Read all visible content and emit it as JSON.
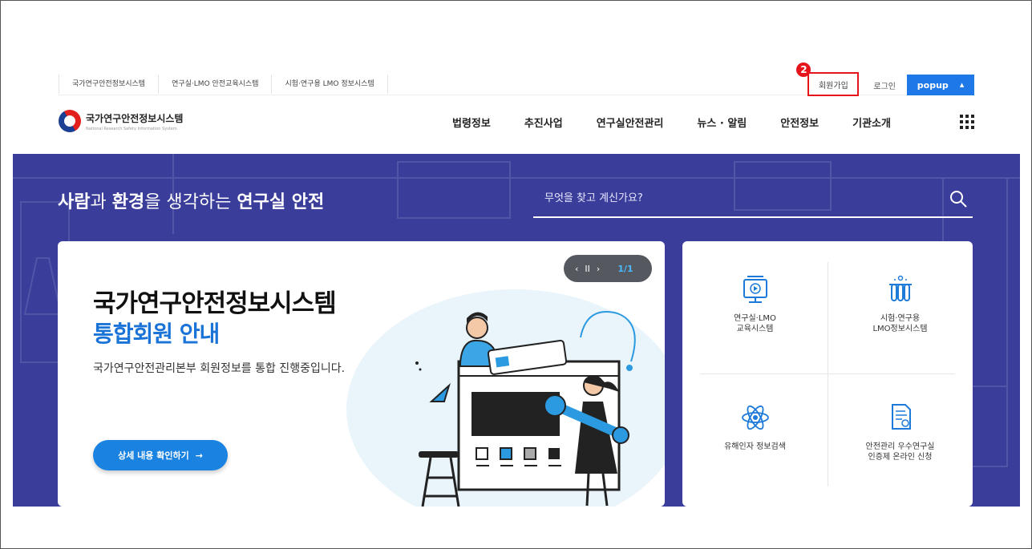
{
  "util": {
    "links": [
      "국가연구안전정보시스템",
      "연구실·LMO 안전교육시스템",
      "시험·연구용 LMO 정보시스템"
    ],
    "join": "회원가입",
    "annotation_number": "2",
    "login": "로그인",
    "popup": "popup"
  },
  "header": {
    "logo_kr": "국가연구안전정보시스템",
    "logo_en": "National Research Safety Information System",
    "menu": [
      "법령정보",
      "추진사업",
      "연구실안전관리",
      "뉴스 · 알림",
      "안전정보",
      "기관소개"
    ]
  },
  "hero": {
    "title_part1": "사람",
    "title_part2": "과 ",
    "title_part3": "환경",
    "title_part4": "을 생각하는 ",
    "title_part5": "연구실 안전",
    "search_placeholder": "무엇을 찾고 계신가요?"
  },
  "banner": {
    "title": "국가연구안전정보시스템",
    "subtitle": "통합회원 안내",
    "description": "국가연구안전관리본부 회원정보를 통합 진행중입니다.",
    "button": "상세 내용 확인하기",
    "slide_counter": "1/1"
  },
  "services": [
    {
      "label": "연구실·LMO\n교육시스템",
      "icon": "monitor-play-icon"
    },
    {
      "label": "시험·연구용\nLMO정보시스템",
      "icon": "test-tubes-icon"
    },
    {
      "label": "유해인자 정보검색",
      "icon": "atom-icon"
    },
    {
      "label": "안전관리 우수연구실\n인증제 온라인 신청",
      "icon": "document-certificate-icon"
    }
  ],
  "colors": {
    "hero_bg": "#3a3d9a",
    "accent_blue": "#1a82e0",
    "popup_blue": "#1e78e8",
    "highlight_red": "#e5151b"
  }
}
